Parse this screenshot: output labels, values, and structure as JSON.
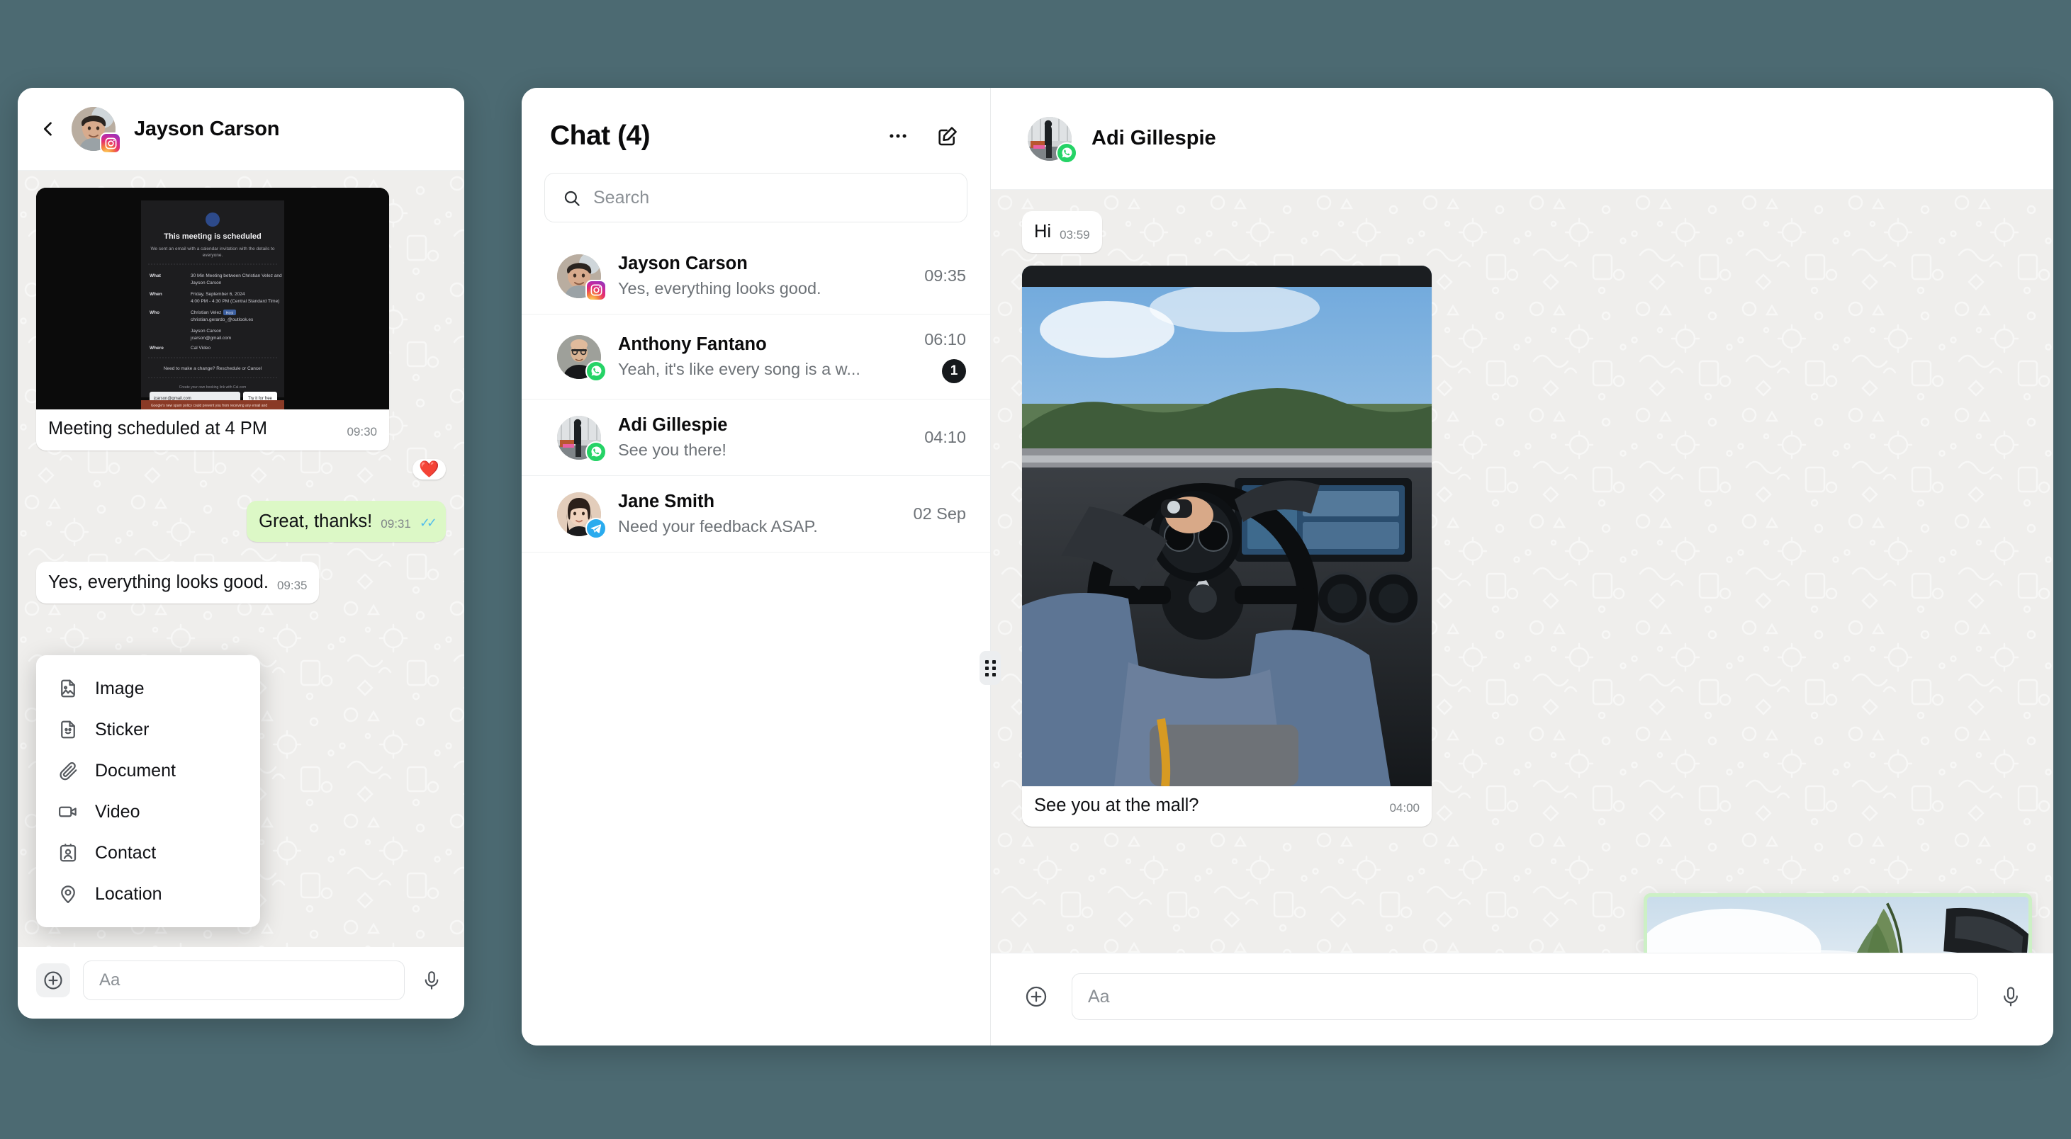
{
  "theme": {
    "desktop_background": "#4c6a72",
    "outgoing_bubble": "#dcf8c6",
    "chat_background": "#efeeec",
    "unread_badge": "#16191c",
    "tick_blue": "#53bdeb",
    "drag_highlight": "#ccf0c5"
  },
  "left_window": {
    "header": {
      "back_icon": "chevron-left-icon",
      "contact_name": "Jayson Carson",
      "platform_badge": "instagram-icon"
    },
    "messages": [
      {
        "type": "media",
        "caption": "Meeting scheduled at 4 PM",
        "time": "09:30",
        "reaction": "❤️",
        "preview": {
          "title": "This meeting is scheduled",
          "subtitle": "We sent an email with a calendar invitation with the details to everyone.",
          "rows": [
            {
              "label": "What",
              "value": "30 Min Meeting between Christian Velez and Jayson Carson"
            },
            {
              "label": "When",
              "value": "Friday, September 6, 2024 4:00 PM - 4:30 PM (Central Standard Time)"
            },
            {
              "label": "Who",
              "value": "Christian Velez Host christian.gerardo_@outlook.es Jayson Carson jcarson@gmail.com"
            },
            {
              "label": "Where",
              "value": "Cal Video"
            }
          ],
          "footer_note": "Need to make a change? Reschedule or Cancel",
          "promo": "Create your own booking link with Cal.com",
          "promo_email": "jcarson@gmail.com",
          "promo_button": "Try it for free",
          "warning": "Google's new spam policy could prevent you from receiving any email and calendar notifications about this booking."
        }
      },
      {
        "type": "text",
        "direction": "out",
        "text": "Great, thanks!",
        "time": "09:31",
        "status": "read"
      },
      {
        "type": "text",
        "direction": "in",
        "text": "Yes, everything looks good.",
        "time": "09:35"
      }
    ],
    "attach_menu": [
      {
        "label": "Image",
        "icon": "image-file-icon"
      },
      {
        "label": "Sticker",
        "icon": "sticker-file-icon"
      },
      {
        "label": "Document",
        "icon": "paperclip-icon"
      },
      {
        "label": "Video",
        "icon": "video-camera-icon"
      },
      {
        "label": "Contact",
        "icon": "contact-card-icon"
      },
      {
        "label": "Location",
        "icon": "map-pin-icon"
      }
    ],
    "composer": {
      "plus_icon": "plus-circle-icon",
      "placeholder": "Aa",
      "mic_icon": "microphone-icon"
    }
  },
  "main_window": {
    "list_pane": {
      "title": "Chat  (4)",
      "more_icon": "ellipsis-icon",
      "compose_icon": "compose-pencil-icon",
      "search": {
        "icon": "search-icon",
        "placeholder": "Search"
      },
      "items": [
        {
          "name": "Jayson Carson",
          "preview": "Yes, everything looks good.",
          "time": "09:35",
          "platform": "instagram",
          "unread": ""
        },
        {
          "name": "Anthony Fantano",
          "preview": "Yeah, it's like every song is a w...",
          "time": "06:10",
          "platform": "whatsapp",
          "unread": "1"
        },
        {
          "name": "Adi Gillespie",
          "preview": "See you there!",
          "time": "04:10",
          "platform": "whatsapp",
          "unread": ""
        },
        {
          "name": "Jane Smith",
          "preview": "Need your feedback ASAP.",
          "time": "02 Sep",
          "platform": "telegram",
          "unread": ""
        }
      ],
      "resize_handle": "resize-grip-icon"
    },
    "conversation": {
      "header": {
        "contact_name": "Adi Gillespie",
        "platform_badge": "whatsapp-icon"
      },
      "messages": [
        {
          "type": "text",
          "direction": "in",
          "text": "Hi",
          "time": "03:59"
        },
        {
          "type": "media",
          "caption": "See you at the mall?",
          "time": "04:00",
          "image_alt": "driving-photo"
        }
      ],
      "drag_preview": {
        "alt": "dragged-image-preview"
      },
      "composer": {
        "plus_icon": "plus-circle-icon",
        "placeholder": "Aa",
        "mic_icon": "microphone-icon"
      }
    }
  }
}
